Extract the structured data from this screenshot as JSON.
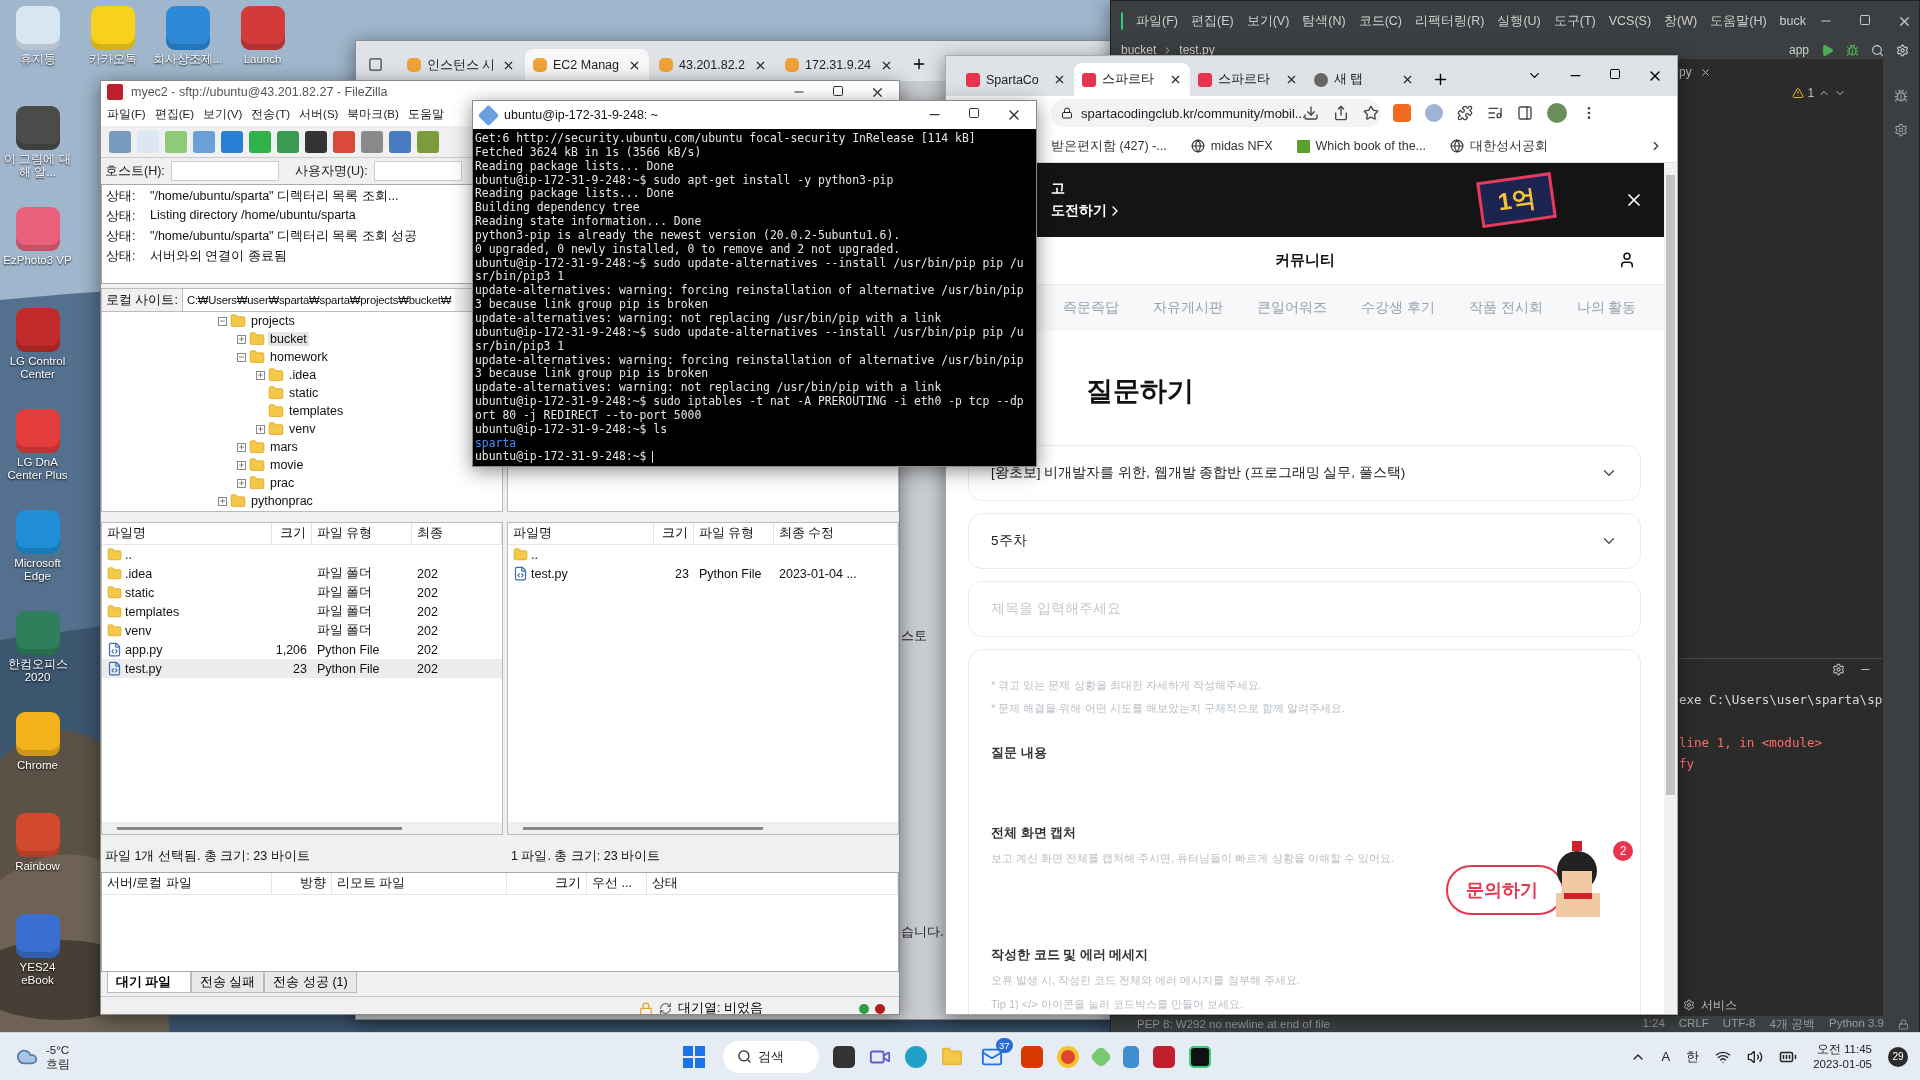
{
  "desktop": {
    "top_icons": [
      {
        "label": "휴지통"
      },
      {
        "label": "카카오톡"
      },
      {
        "label": "회사상조제..."
      },
      {
        "label": "Launch"
      }
    ],
    "side_icons": [
      {
        "label": "이 그림에 대해 알..."
      },
      {
        "label": "EzPhoto3 VP"
      },
      {
        "label": "LG Control Center"
      },
      {
        "label": "LG DnA Center Plus"
      },
      {
        "label": "Microsoft Edge"
      },
      {
        "label": "한컴오피스 2020"
      },
      {
        "label": "Chrome"
      },
      {
        "label": "Rainbow"
      },
      {
        "label": "YES24 eBook"
      }
    ]
  },
  "edge_window": {
    "tabs": [
      {
        "title": "인스턴스 시",
        "selected": false
      },
      {
        "title": "EC2 Manag",
        "selected": true
      },
      {
        "title": "43.201.82.2",
        "selected": false
      },
      {
        "title": "172.31.9.24",
        "selected": false
      }
    ],
    "fragments": [
      "스토",
      "습니다."
    ]
  },
  "pycharm": {
    "menu": [
      "파일(F)",
      "편집(E)",
      "보기(V)",
      "탐색(N)",
      "코드(C)",
      "리팩터링(R)",
      "실행(U)",
      "도구(T)",
      "VCS(S)",
      "창(W)",
      "도움말(H)",
      "buck"
    ],
    "breadcrumbs": [
      "bucket",
      "test.py"
    ],
    "run_config": "app",
    "editor_tab": "py",
    "warning_count": "1",
    "run_lines": [
      {
        "text": "exe C:\\Users\\user\\sparta\\sp",
        "kind": "plain"
      },
      {
        "text": "line 1, in <module>",
        "kind": "error"
      },
      {
        "text": "fy",
        "kind": "error"
      }
    ],
    "services": "서비스",
    "status": {
      "message": "PEP 8: W292 no newline at end of file",
      "items": [
        "1:24",
        "CRLF",
        "UTF-8",
        "4개 공백",
        "Python 3.9"
      ]
    }
  },
  "filezilla": {
    "title": "myec2 - sftp://ubuntu@43.201.82.27 - FileZilla",
    "menu": [
      "파일(F)",
      "편집(E)",
      "보기(V)",
      "전송(T)",
      "서버(S)",
      "북마크(B)",
      "도움말"
    ],
    "host_label": "호스트(H):",
    "user_label": "사용자명(U):",
    "log": [
      {
        "label": "상태:",
        "text": "\"/home/ubuntu/sparta\" 디렉터리 목록 조회..."
      },
      {
        "label": "상태:",
        "text": "Listing directory /home/ubuntu/sparta"
      },
      {
        "label": "상태:",
        "text": "\"/home/ubuntu/sparta\" 디렉터리 목록 조회 성공"
      },
      {
        "label": "상태:",
        "text": "서버와의 연결이 종료됨"
      }
    ],
    "local_site_label": "로컬 사이트:",
    "local_path": "C:₩Users₩user₩sparta₩sparta₩projects₩bucket₩",
    "tree": [
      {
        "name": "projects",
        "expanded": true,
        "selected": false,
        "children": [
          {
            "name": "bucket",
            "expanded": false,
            "selected": true
          },
          {
            "name": "homework",
            "expanded": true,
            "selected": false,
            "children": [
              {
                "name": ".idea",
                "expanded": false,
                "selected": false
              },
              {
                "name": "static",
                "selected": false
              },
              {
                "name": "templates",
                "selected": false
              },
              {
                "name": "venv",
                "expanded": false,
                "selected": false
              }
            ]
          },
          {
            "name": "mars",
            "expanded": false,
            "selected": false
          },
          {
            "name": "movie",
            "expanded": false,
            "selected": false
          },
          {
            "name": "prac",
            "expanded": false,
            "selected": false
          }
        ]
      },
      {
        "name": "pythonprac",
        "expanded": false,
        "selected": false
      }
    ],
    "local_columns": [
      "파일명",
      "크기",
      "파일 유형",
      "최종"
    ],
    "local_files": [
      {
        "name": "..",
        "kind": "folder",
        "selected": false
      },
      {
        "name": ".idea",
        "kind": "folder",
        "type": "파일 폴더",
        "modified": "202",
        "selected": false
      },
      {
        "name": "static",
        "kind": "folder",
        "type": "파일 폴더",
        "modified": "202",
        "selected": false
      },
      {
        "name": "templates",
        "kind": "folder",
        "type": "파일 폴더",
        "modified": "202",
        "selected": false
      },
      {
        "name": "venv",
        "kind": "folder",
        "type": "파일 폴더",
        "modified": "202",
        "selected": false
      },
      {
        "name": "app.py",
        "kind": "python",
        "size": "1,206",
        "type": "Python File",
        "modified": "202",
        "selected": false
      },
      {
        "name": "test.py",
        "kind": "python",
        "size": "23",
        "type": "Python File",
        "modified": "202",
        "selected": true
      }
    ],
    "remote_columns": [
      "파일명",
      "크기",
      "파일 유형",
      "최종 수정"
    ],
    "remote_files": [
      {
        "name": "..",
        "kind": "folder",
        "selected": false
      },
      {
        "name": "test.py",
        "kind": "python",
        "size": "23",
        "type": "Python File",
        "modified": "2023-01-04 ...",
        "selected": false
      }
    ],
    "local_status": "파일 1개 선택됨. 총 크기: 23 바이트",
    "remote_status": "1 파일. 총 크기: 23 바이트",
    "queue_columns": [
      "서버/로컬 파일",
      "방향",
      "리모트 파일",
      "크기",
      "우선 ...",
      "상태"
    ],
    "queue_tabs": [
      {
        "label": "대기 파일",
        "selected": true
      },
      {
        "label": "전송 실패",
        "selected": false
      },
      {
        "label": "전송 성공 (1)",
        "selected": false
      }
    ],
    "queue_status": "대기열: 비었음"
  },
  "terminal": {
    "title": "ubuntu@ip-172-31-9-248: ~",
    "lines": [
      {
        "text": "Get:6 http://security.ubuntu.com/ubuntu focal-security InRelease [114 kB]",
        "kind": "output"
      },
      {
        "text": "Fetched 3624 kB in 1s (3566 kB/s)",
        "kind": "output"
      },
      {
        "text": "Reading package lists... Done",
        "kind": "output"
      },
      {
        "text": "ubuntu@ip-172-31-9-248:~$ sudo apt-get install -y python3-pip",
        "kind": "output"
      },
      {
        "text": "Reading package lists... Done",
        "kind": "output"
      },
      {
        "text": "Building dependency tree",
        "kind": "output"
      },
      {
        "text": "Reading state information... Done",
        "kind": "output"
      },
      {
        "text": "python3-pip is already the newest version (20.0.2-5ubuntu1.6).",
        "kind": "output"
      },
      {
        "text": "0 upgraded, 0 newly installed, 0 to remove and 2 not upgraded.",
        "kind": "output"
      },
      {
        "text": "ubuntu@ip-172-31-9-248:~$ sudo update-alternatives --install /usr/bin/pip pip /u",
        "kind": "output"
      },
      {
        "text": "sr/bin/pip3 1",
        "kind": "output"
      },
      {
        "text": "update-alternatives: warning: forcing reinstallation of alternative /usr/bin/pip",
        "kind": "output"
      },
      {
        "text": "3 because link group pip is broken",
        "kind": "output"
      },
      {
        "text": "update-alternatives: warning: not replacing /usr/bin/pip with a link",
        "kind": "output"
      },
      {
        "text": "ubuntu@ip-172-31-9-248:~$ sudo update-alternatives --install /usr/bin/pip pip /u",
        "kind": "output"
      },
      {
        "text": "sr/bin/pip3 1",
        "kind": "output"
      },
      {
        "text": "update-alternatives: warning: forcing reinstallation of alternative /usr/bin/pip",
        "kind": "output"
      },
      {
        "text": "3 because link group pip is broken",
        "kind": "output"
      },
      {
        "text": "update-alternatives: warning: not replacing /usr/bin/pip with a link",
        "kind": "output"
      },
      {
        "text": "ubuntu@ip-172-31-9-248:~$ sudo iptables -t nat -A PREROUTING -i eth0 -p tcp --dp",
        "kind": "output"
      },
      {
        "text": "ort 80 -j REDIRECT --to-port 5000",
        "kind": "output"
      },
      {
        "text": "ubuntu@ip-172-31-9-248:~$ ls",
        "kind": "output"
      },
      {
        "text": "sparta",
        "kind": "dir"
      },
      {
        "text": "ubuntu@ip-172-31-9-248:~$",
        "kind": "output"
      }
    ]
  },
  "chrome": {
    "tabs": [
      {
        "title": "SpartaCo",
        "selected": false
      },
      {
        "title": "스파르타",
        "selected": true
      },
      {
        "title": "스파르타",
        "selected": false
      },
      {
        "title": "새 탭",
        "selected": false
      }
    ],
    "url": "spartacodingclub.kr/community/mobil...",
    "bookmarks": [
      "받은편지함 (427) -...",
      "midas NFX",
      "Which book of the...",
      "대한성서공회"
    ],
    "banner": {
      "line_1": "고",
      "line_2": "도전하기",
      "badge": "1억"
    },
    "page_title": "커뮤니티",
    "nav": [
      "즉문즉답",
      "자유게시판",
      "큰일어워즈",
      "수강생 후기",
      "작품 전시회",
      "나의 활동"
    ],
    "heading": "질문하기",
    "course": "[왕초보] 비개발자를 위한, 웹개발 종합반 (프로그래밍 실무, 풀스택)",
    "week": "5주차",
    "title_placeholder": "제목을 입력해주세요",
    "hints": [
      "* 겪고 있는 문제 상황을 최대한 자세하게 작성해주세요.",
      "* 문제 해결을 위해 어떤 시도를 해보았는지 구체적으로 함께 알려주세요."
    ],
    "sections": [
      {
        "title": "질문 내용"
      },
      {
        "title": "전체 화면 캡처",
        "lines": [
          "보고 계신 화면 전체를 캡처해 주시면, 튜터님들이 빠르게 상황을 이해할 수 있어요."
        ]
      },
      {
        "title": "작성한 코드 및 에러 메세지",
        "lines": [
          "오류 발생 시, 작성한 코드 전체와 에러 메시지를 첨부해 주세요.",
          "Tip 1) </> 아이콘을 눌러 코드박스를 만들어 보세요."
        ]
      }
    ],
    "help_button": "문의하기",
    "help_badge": "2"
  },
  "taskbar": {
    "temp": "-5°C",
    "condition": "흐림",
    "search": "검색",
    "mail_badge": "37",
    "tray": [
      "A",
      "한"
    ],
    "time": "오전 11:45",
    "date": "2023-01-05",
    "notifications": "29"
  }
}
